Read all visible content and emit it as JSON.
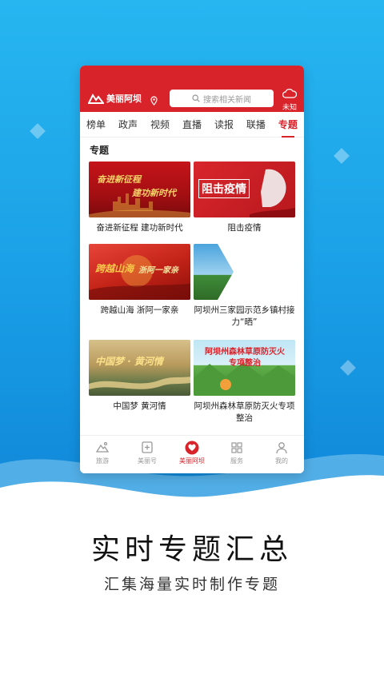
{
  "app": {
    "logo_text": "美丽阿坝"
  },
  "search": {
    "placeholder": "搜索相关新闻"
  },
  "weather": {
    "label": "未知"
  },
  "tabs": [
    "榜单",
    "政声",
    "视频",
    "直播",
    "读报",
    "联播",
    "专题"
  ],
  "active_tab": "专题",
  "section": {
    "title": "专题"
  },
  "cards": [
    {
      "caption": "奋进新征程 建功新时代",
      "thumb_text_1": "奋进新征程",
      "thumb_text_2": "建功新时代"
    },
    {
      "caption": "阻击疫情",
      "thumb_text_1": "阻击疫情"
    },
    {
      "caption": "跨越山海 浙阿一家亲",
      "thumb_text_1": "跨越山海",
      "thumb_text_2": "浙阿一家亲"
    },
    {
      "caption": "阿坝州三家园示范乡镇村接力“晒”"
    },
    {
      "caption": "中国梦 黄河情",
      "thumb_text_1": "中国梦 · 黄河情"
    },
    {
      "caption": "阿坝州森林草原防灭火专项整治",
      "thumb_text_1": "阿坝州森林草原防灭火",
      "thumb_text_2": "专项整治"
    }
  ],
  "bottom_nav": [
    {
      "label": "旅游",
      "icon": "mountain-icon"
    },
    {
      "label": "美丽号",
      "icon": "plus-square-icon"
    },
    {
      "label": "美丽阿坝",
      "icon": "heart-logo-icon"
    },
    {
      "label": "服务",
      "icon": "grid-icon"
    },
    {
      "label": "我的",
      "icon": "user-icon"
    }
  ],
  "promo": {
    "title": "实时专题汇总",
    "subtitle": "汇集海量实时制作专题"
  },
  "colors": {
    "brand_red": "#d9232a",
    "sky_blue": "#1a9fe6"
  }
}
